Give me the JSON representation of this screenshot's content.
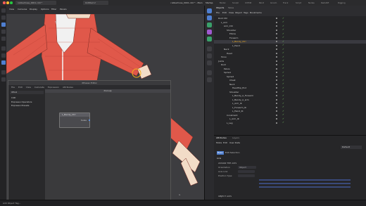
{
  "window": {
    "title": "rubberhose_0001.c4d * - Main"
  },
  "tabs": [
    "rubberhose_0001.c4d *",
    "Untitled 2"
  ],
  "modes": [
    "Startup",
    "Model",
    "Sculpt",
    "UVEdit",
    "Paint",
    "Groom",
    "Track",
    "Script",
    "Nodes",
    "Redshift",
    "Rigging"
  ],
  "viewport": {
    "menu": [
      "View",
      "Cameras",
      "Display",
      "Options",
      "Filter",
      "Panels"
    ]
  },
  "xpresso": {
    "title": "XPresso Editor",
    "menu": [
      "File",
      "Edit",
      "View",
      "Calculate",
      "Expression",
      "Attributes"
    ],
    "pool_label": "XPool",
    "pool_items": [
      "C4D",
      "Expresso Operators",
      "Expresso Presets"
    ],
    "canvas_title": "XGroup",
    "node_name": "L_Bendy_Ctrl",
    "node_port": "Scale"
  },
  "objects_panel": {
    "tabs": [
      "Objects",
      "Takes"
    ],
    "menu": [
      "File",
      "Edit",
      "View",
      "Object",
      "Tags",
      "Bookmarks"
    ],
    "rows": [
      {
        "label": "Root Ctrl",
        "depth": 1
      },
      {
        "label": "L_Arm",
        "depth": 2
      },
      {
        "label": "Arm_Ctrl",
        "depth": 3
      },
      {
        "label": "Shoulder",
        "depth": 4
      },
      {
        "label": "Elbow",
        "depth": 5
      },
      {
        "label": "Forearm",
        "depth": 5
      },
      {
        "label": "L_Bendy_Ctrl",
        "depth": 6
      },
      {
        "label": "L_Hand",
        "depth": 6
      },
      {
        "label": "Neck",
        "depth": 3
      },
      {
        "label": "Head",
        "depth": 4
      },
      {
        "label": "Torso",
        "depth": 2
      },
      {
        "label": "Joints",
        "depth": 1
      },
      {
        "label": "Root",
        "depth": 2
      },
      {
        "label": "Pelvis",
        "depth": 3
      },
      {
        "label": "Spine1",
        "depth": 3
      },
      {
        "label": "Spine2",
        "depth": 4
      },
      {
        "label": "Chest",
        "depth": 5
      },
      {
        "label": "Neck",
        "depth": 5
      },
      {
        "label": "HeadTop_End",
        "depth": 6
      },
      {
        "label": "Shoulder",
        "depth": 5
      },
      {
        "label": "L_Bendy_A_Forearm",
        "depth": 6
      },
      {
        "label": "L_Bendy_A_arm",
        "depth": 6
      },
      {
        "label": "L_Arm_IK",
        "depth": 6
      },
      {
        "label": "L_Forearm_IK",
        "depth": 6
      },
      {
        "label": "L_Hand_IK",
        "depth": 6
      },
      {
        "label": "Constraint",
        "depth": 4
      },
      {
        "label": "L_Arm_IK",
        "depth": 5
      },
      {
        "label": "L_Leg",
        "depth": 4
      }
    ]
  },
  "attributes": {
    "title": "Attributes",
    "tabs": [
      "Layers"
    ],
    "menu": [
      "Mode",
      "Edit",
      "User Data"
    ],
    "sections": [
      "Basic",
      "Edit Selection"
    ],
    "group": "Axis",
    "subsection": "ASSIGN THE AXIS",
    "fields": [
      "Orientation",
      "Axis Link",
      "Position Type"
    ],
    "field_values": [
      "Object",
      "",
      ""
    ],
    "second_section": "OBJECT AXIS",
    "dropdown": "Default"
  },
  "status": {
    "text": "Add Object Tag..."
  },
  "colors": {
    "accent": "#5b8ddb",
    "check": "#7fd16a",
    "hoodie": "#e0584a"
  }
}
